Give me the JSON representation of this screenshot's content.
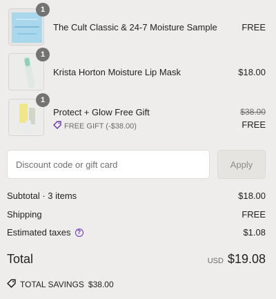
{
  "line_items": [
    {
      "quantity": "1",
      "name": "The Cult Classic & 24-7 Moisture Sample",
      "price": "FREE"
    },
    {
      "quantity": "1",
      "name": "Krista Horton Moisture Lip Mask",
      "price": "$18.00"
    },
    {
      "quantity": "1",
      "name": "Protect + Glow Free Gift",
      "original_price": "$38.00",
      "price": "FREE",
      "gift_label": "FREE GIFT (-$38.00)"
    }
  ],
  "discount": {
    "placeholder": "Discount code or gift card",
    "apply_label": "Apply"
  },
  "summary": {
    "subtotal_label": "Subtotal · 3 items",
    "subtotal_value": "$18.00",
    "shipping_label": "Shipping",
    "shipping_value": "FREE",
    "taxes_label": "Estimated taxes",
    "taxes_value": "$1.08",
    "total_label": "Total",
    "currency": "USD",
    "total_value": "$19.08",
    "savings_label": "TOTAL SAVINGS",
    "savings_value": "$38.00"
  },
  "colors": {
    "background": "#efedeb",
    "accent": "#6b2fb7",
    "badge": "#737373"
  },
  "icons": [
    "tag-icon",
    "help-icon",
    "savings-tag-icon"
  ]
}
